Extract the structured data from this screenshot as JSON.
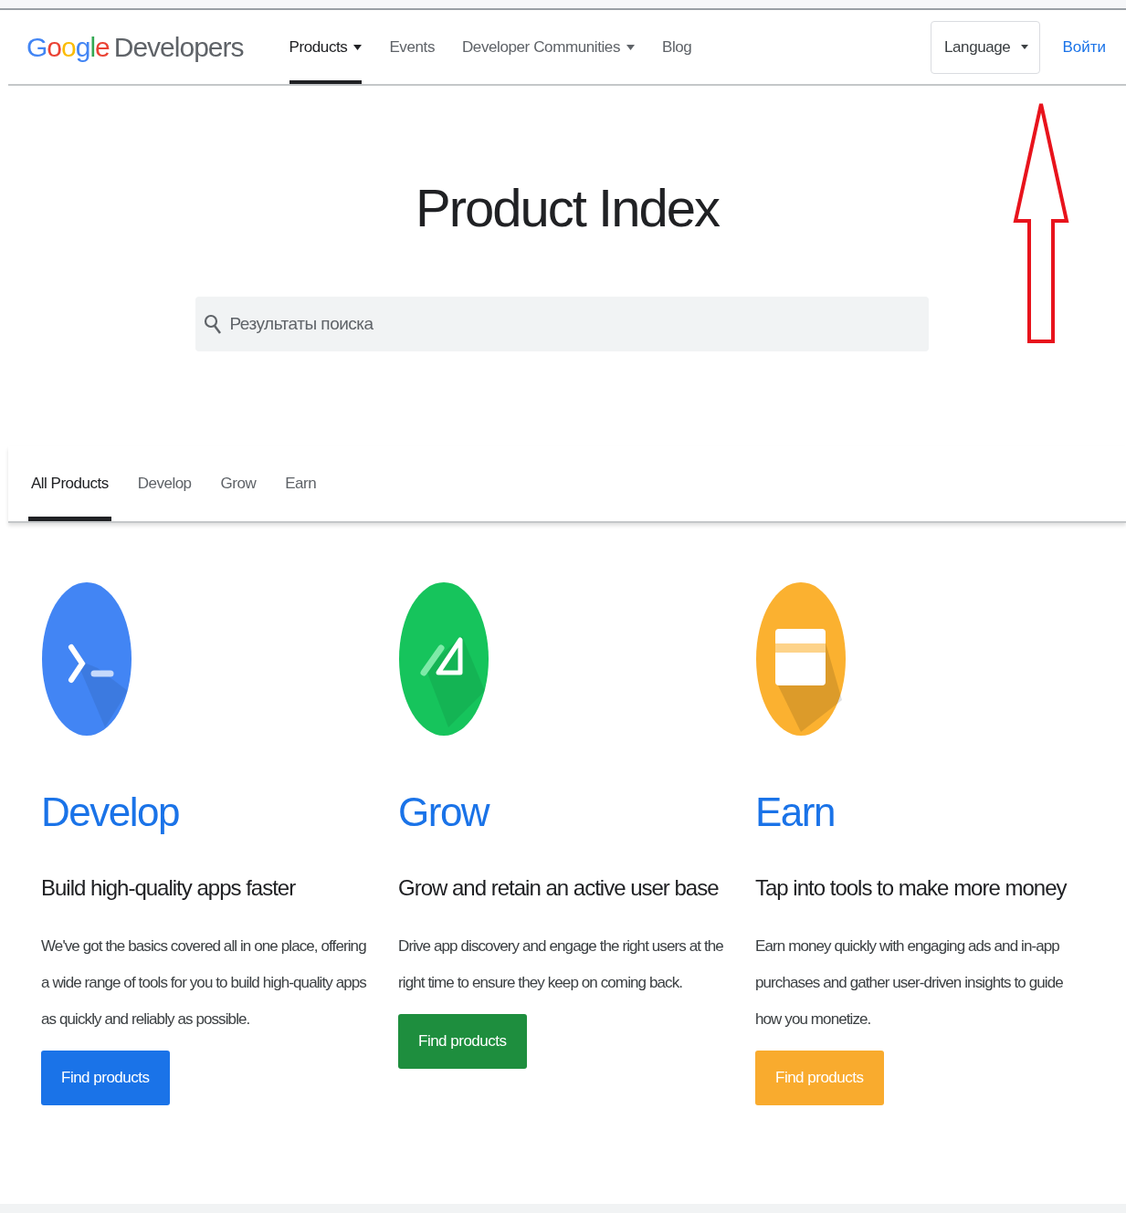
{
  "header": {
    "logo": {
      "brand": "Google",
      "product": "Developers"
    },
    "nav": [
      {
        "label": "Products",
        "dropdown": true,
        "selected": true
      },
      {
        "label": "Events",
        "dropdown": false,
        "selected": false
      },
      {
        "label": "Developer Communities",
        "dropdown": true,
        "selected": false
      },
      {
        "label": "Blog",
        "dropdown": false,
        "selected": false
      }
    ],
    "language": "Language",
    "sign_in": "Войти"
  },
  "title": "Product Index",
  "search": {
    "placeholder": "Результаты поиска"
  },
  "tabs": [
    {
      "label": "All Products",
      "selected": true
    },
    {
      "label": "Develop",
      "selected": false
    },
    {
      "label": "Grow",
      "selected": false
    },
    {
      "label": "Earn",
      "selected": false
    }
  ],
  "cards": [
    {
      "kind": "terminal",
      "color": "#4285f4",
      "title": "Develop",
      "subtitle": "Build high-quality apps faster",
      "text": "We've got the basics covered all in one place, offering a wide range of tools for you to build high-quality apps as quickly and reliably as possible.",
      "button": "Find products"
    },
    {
      "kind": "ruler",
      "color": "#16c45c",
      "title": "Grow",
      "subtitle": "Grow and retain an active user base",
      "text": "Drive app discovery and engage the right users at the right time to ensure they keep on coming back.",
      "button": "Find products"
    },
    {
      "kind": "card",
      "color": "#fbb130",
      "title": "Earn",
      "subtitle": "Tap into tools to make more money",
      "text": "Earn money quickly with engaging ads and in-app purchases and gather user-driven insights to guide how you monetize.",
      "button": "Find products"
    }
  ]
}
